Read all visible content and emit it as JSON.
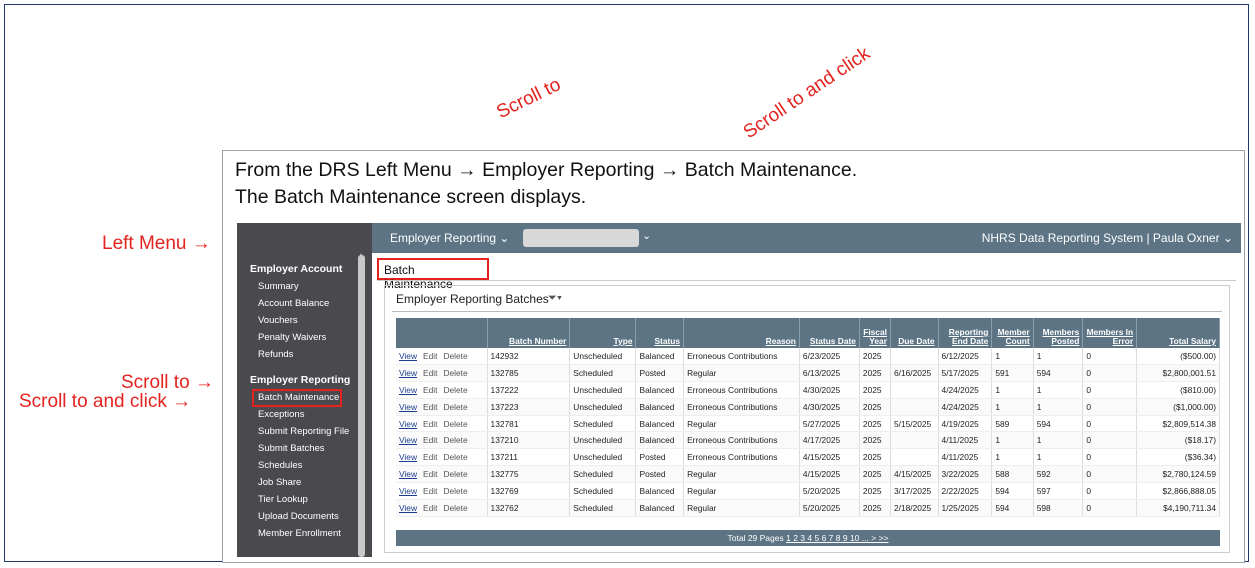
{
  "annotations": {
    "scroll_to_top": "Scroll to",
    "scroll_to_and_click_top": "Scroll to and click",
    "left_menu": "Left Menu →",
    "scroll_to_left": "Scroll to →",
    "scroll_to_and_click_left": "Scroll to and click →"
  },
  "instructions": {
    "line1": "From the DRS Left Menu → Employer Reporting → Batch Maintenance.",
    "line2": "The Batch Maintenance screen displays."
  },
  "topbar": {
    "menu_label": "Employer Reporting ⌄",
    "select_chevron": "⌄",
    "system_user": "NHRS Data Reporting System  |  Paula Oxner ⌄"
  },
  "sidebar": {
    "account_header": "Employer Account",
    "account_items": [
      "Summary",
      "Account Balance",
      "Vouchers",
      "Penalty Waivers",
      "Refunds"
    ],
    "reporting_header": "Employer Reporting",
    "reporting_items": [
      "Batch Maintenance",
      "Exceptions",
      "Submit Reporting File",
      "Submit Batches",
      "Schedules",
      "Job Share",
      "Tier Lookup",
      "Upload Documents",
      "Member Enrollment"
    ]
  },
  "page": {
    "breadcrumb": "Batch Maintenance",
    "section_title": "Employer Reporting Batches",
    "filter_icon": "filter-icon"
  },
  "table": {
    "headers": [
      "",
      "Batch Number",
      "Type",
      "Status",
      "Reason",
      "Status Date",
      "Fiscal Year",
      "Due Date",
      "Reporting End Date",
      "Member Count",
      "Members Posted",
      "Members In Error",
      "Total Salary"
    ],
    "actions": [
      "View",
      "Edit",
      "Delete"
    ],
    "rows": [
      [
        "142932",
        "Unscheduled",
        "Balanced",
        "Erroneous Contributions",
        "6/23/2025",
        "2025",
        "",
        "6/12/2025",
        "1",
        "1",
        "0",
        "($500.00)"
      ],
      [
        "132785",
        "Scheduled",
        "Posted",
        "Regular",
        "6/13/2025",
        "2025",
        "6/16/2025",
        "5/17/2025",
        "591",
        "594",
        "0",
        "$2,800,001.51"
      ],
      [
        "137222",
        "Unscheduled",
        "Balanced",
        "Erroneous Contributions",
        "4/30/2025",
        "2025",
        "",
        "4/24/2025",
        "1",
        "1",
        "0",
        "($810.00)"
      ],
      [
        "137223",
        "Unscheduled",
        "Balanced",
        "Erroneous Contributions",
        "4/30/2025",
        "2025",
        "",
        "4/24/2025",
        "1",
        "1",
        "0",
        "($1,000.00)"
      ],
      [
        "132781",
        "Scheduled",
        "Balanced",
        "Regular",
        "5/27/2025",
        "2025",
        "5/15/2025",
        "4/19/2025",
        "589",
        "594",
        "0",
        "$2,809,514.38"
      ],
      [
        "137210",
        "Unscheduled",
        "Balanced",
        "Erroneous Contributions",
        "4/17/2025",
        "2025",
        "",
        "4/11/2025",
        "1",
        "1",
        "0",
        "($18.17)"
      ],
      [
        "137211",
        "Unscheduled",
        "Posted",
        "Erroneous Contributions",
        "4/15/2025",
        "2025",
        "",
        "4/11/2025",
        "1",
        "1",
        "0",
        "($36.34)"
      ],
      [
        "132775",
        "Scheduled",
        "Posted",
        "Regular",
        "4/15/2025",
        "2025",
        "4/15/2025",
        "3/22/2025",
        "588",
        "592",
        "0",
        "$2,780,124.59"
      ],
      [
        "132769",
        "Scheduled",
        "Balanced",
        "Regular",
        "5/20/2025",
        "2025",
        "3/17/2025",
        "2/22/2025",
        "594",
        "597",
        "0",
        "$2,866,888.05"
      ],
      [
        "132762",
        "Scheduled",
        "Balanced",
        "Regular",
        "5/20/2025",
        "2025",
        "2/18/2025",
        "1/25/2025",
        "594",
        "598",
        "0",
        "$4,190,711.34"
      ]
    ],
    "pager_prefix": "Total 29 Pages",
    "pager_links": [
      "1",
      "2",
      "3",
      "4",
      "5",
      "6",
      "7",
      "8",
      "9",
      "10",
      "...",
      ">",
      ">>"
    ]
  }
}
